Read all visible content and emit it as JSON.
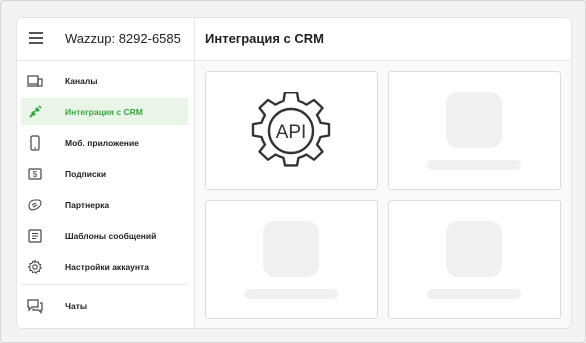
{
  "app": {
    "title": "Wazzup: 8292-6585"
  },
  "header": {
    "title": "Интеграция с CRM"
  },
  "sidebar": {
    "items": [
      {
        "label": "Каналы",
        "icon": "devices-icon",
        "active": false
      },
      {
        "label": "Интеграция с CRM",
        "icon": "plug-icon",
        "active": true
      },
      {
        "label": "Моб. приложение",
        "icon": "phone-icon",
        "active": false
      },
      {
        "label": "Подписки",
        "icon": "dollar-icon",
        "active": false
      },
      {
        "label": "Партнерка",
        "icon": "handshake-icon",
        "active": false
      },
      {
        "label": "Шаблоны сообщений",
        "icon": "template-icon",
        "active": false
      },
      {
        "label": "Настройки аккаунта",
        "icon": "gear-icon",
        "active": false
      },
      {
        "label": "Чаты",
        "icon": "chat-icon",
        "active": false
      }
    ]
  },
  "cards": [
    {
      "name": "api",
      "label": "API"
    },
    {
      "name": "placeholder"
    },
    {
      "name": "placeholder"
    },
    {
      "name": "placeholder"
    }
  ],
  "colors": {
    "accent": "#3aa544",
    "active_bg": "#e9f5e6"
  }
}
